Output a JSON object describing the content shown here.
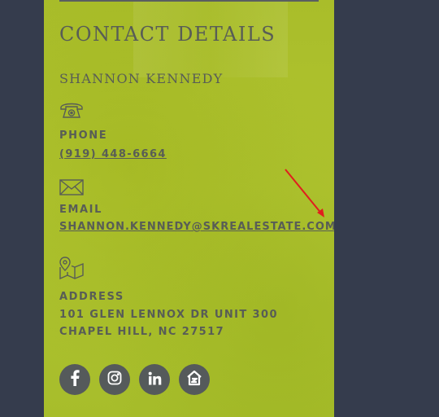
{
  "contact": {
    "title": "CONTACT DETAILS",
    "name": "SHANNON KENNEDY",
    "phone": {
      "label": "PHONE",
      "value": "(919) 448-6664",
      "icon": "phone-icon"
    },
    "email": {
      "label": "EMAIL",
      "value": "SHANNON.KENNEDY@SKREALESTATE.COM",
      "icon": "envelope-icon"
    },
    "address": {
      "label": "ADDRESS",
      "line1": "101 GLEN LENNOX DR UNIT 300",
      "line2": "CHAPEL HILL, NC 27517",
      "icon": "map-pin-icon"
    }
  },
  "socials": [
    {
      "name": "facebook-icon"
    },
    {
      "name": "instagram-icon"
    },
    {
      "name": "linkedin-icon"
    },
    {
      "name": "zillow-icon"
    }
  ],
  "colors": {
    "page_background": "#353c4d",
    "panel_background": "#a9bd2a",
    "text": "#585d56",
    "social_circle": "#555a5b",
    "annotation_arrow": "#e01e1e"
  }
}
